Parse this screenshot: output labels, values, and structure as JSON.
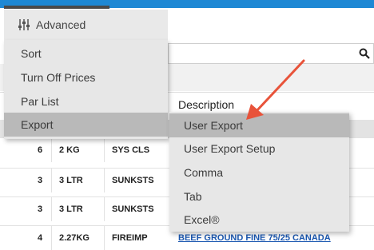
{
  "toolbar": {
    "advanced_label": "Advanced"
  },
  "menu": {
    "items": [
      {
        "label": "Sort"
      },
      {
        "label": "Turn Off Prices"
      },
      {
        "label": "Par List"
      },
      {
        "label": "Export"
      }
    ]
  },
  "submenu": {
    "items": [
      {
        "label": "User Export"
      },
      {
        "label": "User Export Setup"
      },
      {
        "label": "Comma"
      },
      {
        "label": "Tab"
      },
      {
        "label": "Excel®"
      }
    ]
  },
  "table": {
    "description_header": "Description",
    "rows": [
      {
        "qty": "6",
        "size": "2 KG",
        "brand": "SYS CLS",
        "desc": ""
      },
      {
        "qty": "3",
        "size": "3 LTR",
        "brand": "SUNKSTS",
        "desc": ""
      },
      {
        "qty": "3",
        "size": "3 LTR",
        "brand": "SUNKSTS",
        "desc": ""
      },
      {
        "qty": "4",
        "size": "2.27KG",
        "brand": "FIREIMP",
        "desc": "BEEF GROUND FINE 75/25 CANADA"
      }
    ]
  },
  "colors": {
    "accent": "#1e88d4",
    "annotation_arrow": "#e8533a",
    "link": "#1a57b0"
  },
  "icons": {
    "advanced": "sliders-icon",
    "search": "search-icon"
  }
}
